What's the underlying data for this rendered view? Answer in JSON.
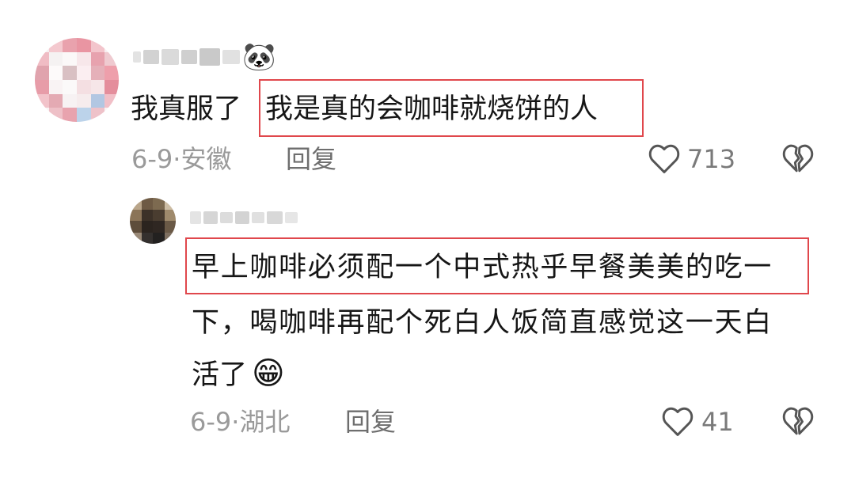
{
  "comments": [
    {
      "username_emoji": "🐼",
      "text_prefix": "我真服了",
      "text_highlight": "我是真的会咖啡就烧饼的人",
      "date": "6-9",
      "location": "安徽",
      "reply_label": "回复",
      "like_count": "713",
      "like_icon": "heart-outline-icon",
      "dislike_icon": "broken-heart-icon"
    },
    {
      "text_highlight": "早上咖啡必须配一个中式热乎早餐美美的吃一",
      "text_line2": "下，喝咖啡再配个死白人饭简直感觉这一天白",
      "text_line3": "活了",
      "text_emoji": "😁",
      "date": "6-9",
      "location": "湖北",
      "reply_label": "回复",
      "like_count": "41",
      "like_icon": "heart-outline-icon",
      "dislike_icon": "broken-heart-icon"
    }
  ],
  "colors": {
    "highlight_border": "#e0474c",
    "meta_text": "#9a9a9a",
    "body_text": "#161616"
  }
}
